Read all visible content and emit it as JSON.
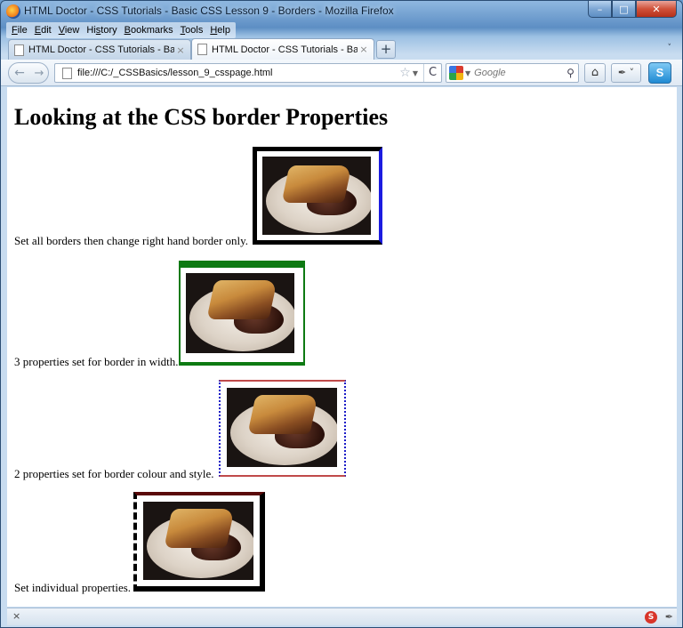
{
  "window": {
    "title": "HTML Doctor - CSS Tutorials - Basic CSS Lesson 9 - Borders - Mozilla Firefox",
    "min_label": "–",
    "max_label": "□",
    "close_label": "✕"
  },
  "menu": [
    {
      "underline": "F",
      "rest": "ile"
    },
    {
      "underline": "E",
      "rest": "dit"
    },
    {
      "underline": "V",
      "rest": "iew"
    },
    {
      "prefix": "Hi",
      "underline": "s",
      "rest": "tory"
    },
    {
      "underline": "B",
      "rest": "ookmarks"
    },
    {
      "underline": "T",
      "rest": "ools"
    },
    {
      "underline": "H",
      "rest": "elp"
    }
  ],
  "tabs": [
    {
      "label": "HTML Doctor - CSS Tutorials - Basic ...",
      "close": "×"
    },
    {
      "label": "HTML Doctor - CSS Tutorials - Basic ...",
      "close": "×"
    }
  ],
  "new_tab_label": "+",
  "tab_list_icon": "˅",
  "nav": {
    "back_icon": "←",
    "forward_icon": "→",
    "url": "file:///C:/_CSSBasics/lesson_9_csspage.html",
    "star_icon": "☆",
    "reload_icon": "C",
    "search_placeholder": "Google",
    "home_icon": "⌂",
    "addon_icon": "✒ ˅",
    "skype_label": "S"
  },
  "content": {
    "heading": "Looking at the CSS border Properties",
    "captions": [
      "Set all borders then change right hand border only.",
      "3 properties set for border in width.",
      "2 properties set for border colour and style.",
      "Set individual properties."
    ]
  },
  "status": {
    "x_label": "×",
    "stop_icon": "S",
    "addon_icon": "✒"
  },
  "colors": {
    "border_blue": "#1c1ce0",
    "border_green": "#0d7a12",
    "border_red": "#c04a4a",
    "border_maroon": "#5a0a0a"
  }
}
